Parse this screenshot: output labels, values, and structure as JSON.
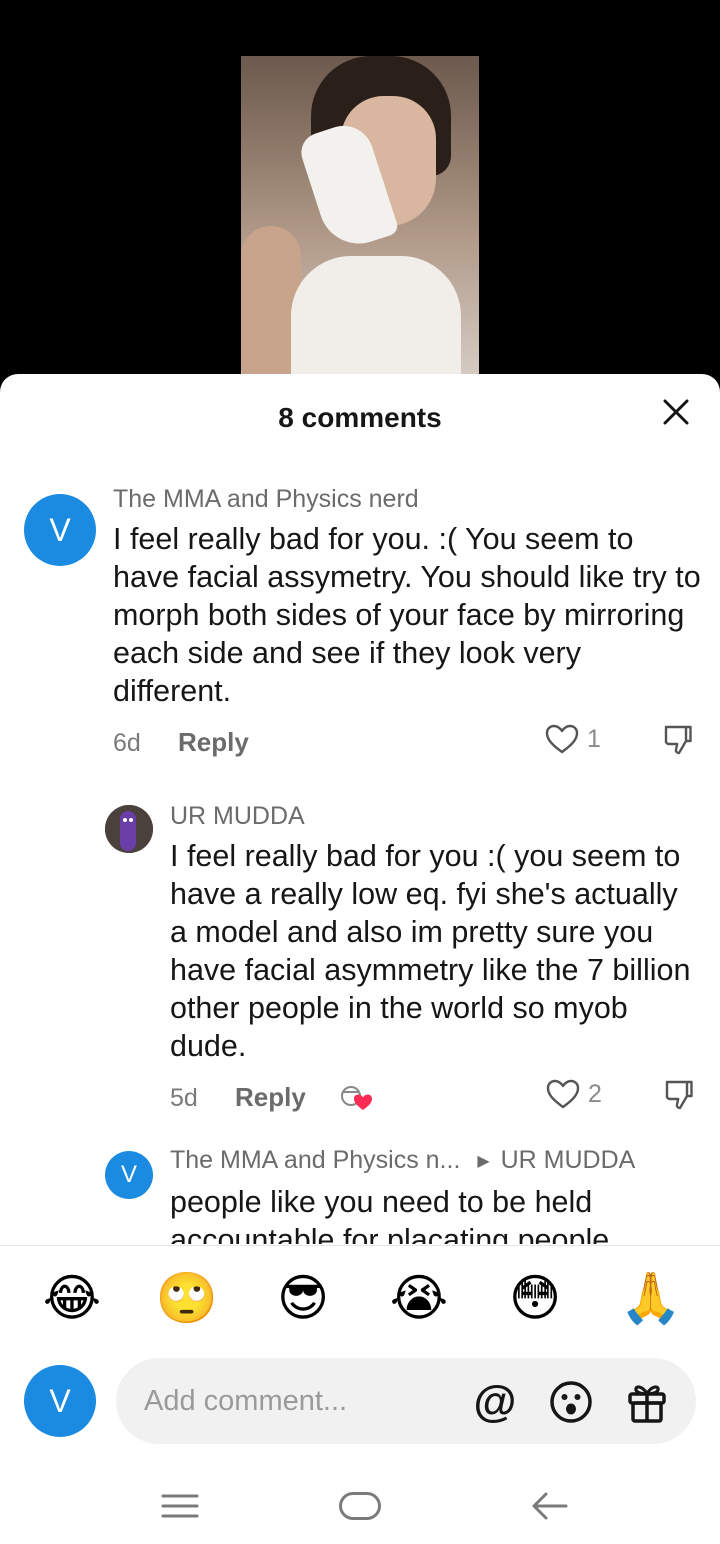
{
  "sheet": {
    "title": "8 comments"
  },
  "comments": [
    {
      "avatar_letter": "V",
      "username": "The MMA and Physics nerd",
      "text": "I feel really bad for you. :( You seem to have facial assymetry. You should like try to morph both sides of your face by mirroring each side and see if they look very different.",
      "age": "6d",
      "reply_label": "Reply",
      "likes": "1"
    },
    {
      "username": "UR MUDDA",
      "text": "I feel really bad for you :( you seem to have a really low eq. fyi she's actually a model and also im pretty sure you have facial asymmetry like the 7 billion other people in the world so myob dude.",
      "age": "5d",
      "reply_label": "Reply",
      "likes": "2"
    },
    {
      "avatar_letter": "V",
      "username": "The MMA and Physics n...",
      "reply_to": "UR MUDDA",
      "text": "people like you need to be held accountable for placating people"
    }
  ],
  "emoji_bar": {
    "items": [
      "😂",
      "🙄",
      "😎",
      "😭",
      "😳",
      "🙏"
    ]
  },
  "composer": {
    "avatar_letter": "V",
    "placeholder": "Add comment..."
  },
  "colors": {
    "avatar_blue": "#1a8be0",
    "heart_red": "#fe2c55"
  }
}
